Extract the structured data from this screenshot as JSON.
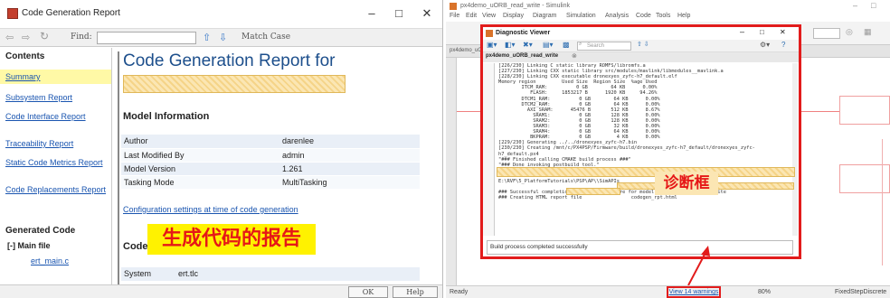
{
  "report_window": {
    "title": "Code Generation Report",
    "find_label": "Find:",
    "match_case": "Match Case",
    "sidebar": {
      "contents_heading": "Contents",
      "items": [
        {
          "label": "Summary",
          "active": true
        },
        {
          "label": "Subsystem Report"
        },
        {
          "label": "Code Interface Report"
        },
        {
          "label": "Traceability Report"
        },
        {
          "label": "Static Code Metrics Report"
        },
        {
          "label": "Code Replacements Report"
        }
      ],
      "generated_code_heading": "Generated Code",
      "main_file_label": "[-] Main file",
      "first_file": "ert_main.c"
    },
    "main": {
      "title": "Code Generation Report for",
      "model_info_heading": "Model Information",
      "info_rows": [
        {
          "label": "Author",
          "value": "darenlee"
        },
        {
          "label": "Last Modified By",
          "value": "admin"
        },
        {
          "label": "Model Version",
          "value": "1.261"
        },
        {
          "label": "Tasking Mode",
          "value": "MultiTasking"
        }
      ],
      "config_link": "Configuration settings at time of code generation",
      "code_heading": "Code",
      "system_label": "System",
      "system_value": "ert.tlc"
    },
    "buttons": {
      "ok": "OK",
      "help": "Help"
    },
    "annotation": "生成代码的报告"
  },
  "simulink_window": {
    "title": "px4demo_uORB_read_write - Simulink",
    "menu": [
      "File",
      "Edit",
      "View",
      "Display",
      "Diagram",
      "Simulation",
      "Analysis",
      "Code",
      "Tools",
      "Help"
    ],
    "model_tab": "px4demo_uORB_read_write",
    "status_left": "Ready",
    "status_warnings": "View 14 warnings",
    "status_zoom": "80%",
    "status_solver": "FixedStepDiscrete",
    "diagnostic_viewer": {
      "title": "Diagnostic Viewer",
      "search_placeholder": "Search",
      "tab": "px4demo_uORB_read_write",
      "log_lines": [
        "[226/230] Linking C static library ROMFS/libromfs.a",
        "[227/230] Linking CXX static library src/modules/mavlink/libmodules__mavlink.a",
        "[228/230] Linking CXX executable dronexyes_zyfc-h7_default.elf",
        "Memory region         Used Size  Region Size  %age Used",
        "        ITCM_RAM:          0 GB        64 KB      0.00%",
        "           FLASH:     1853217 B      1920 KB     94.26%",
        "        DTCM1_RAM:          0 GB        64 KB      0.00%",
        "        DTCM2_RAM:          0 GB        64 KB      0.00%",
        "          AXI_SRAM:      45476 B       512 KB      8.67%",
        "            SRAM1:          0 GB       128 KB      0.00%",
        "            SRAM2:          0 GB       128 KB      0.00%",
        "            SRAM3:          0 GB        32 KB      0.00%",
        "            SRAM4:          0 GB        64 KB      0.00%",
        "           BKPRAM:          0 GB         4 KB      0.00%",
        "[229/230] Generating ../../dronexyes_zyfc-h7.bin",
        "[230/230] Creating /mnt/c/PX4PSP/Firmware/build/dronexyes_zyfc-h7_default/dronexyes_zyfc-",
        "h7_default.px4",
        "\"### Finished calling CMAKE build process ###\"",
        "\"### Done invoking postbuild tool.\"",
        "\"### Successfully generated all binary outputs.\"",
        "",
        "E:\\RVF\\5_PlatformTutorials\\PSP\\AP\\\\SimAPIs",
        "",
        "### Successful completion of build procedure for model: px4demo_uORB_read_write",
        "### Creating HTML report file                 codegen_rpt.html"
      ],
      "final_status": "Build process completed successfully"
    },
    "annotation": "诊断框"
  }
}
